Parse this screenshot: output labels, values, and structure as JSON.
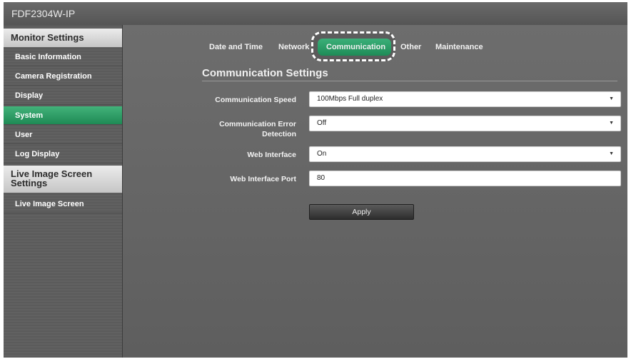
{
  "app": {
    "title": "FDF2304W-IP"
  },
  "sidebar": {
    "sections": [
      {
        "label": "Monitor Settings"
      },
      {
        "label": "Live Image Screen Settings"
      }
    ],
    "items": [
      {
        "label": "Basic Information"
      },
      {
        "label": "Camera Registration"
      },
      {
        "label": "Display"
      },
      {
        "label": "System"
      },
      {
        "label": "User"
      },
      {
        "label": "Log Display"
      },
      {
        "label": "Live Image Screen"
      }
    ],
    "active_item": "System"
  },
  "tabs": [
    {
      "label": "Date and Time"
    },
    {
      "label": "Network"
    },
    {
      "label": "Communication"
    },
    {
      "label": "Other"
    },
    {
      "label": "Maintenance"
    }
  ],
  "active_tab": "Communication",
  "main": {
    "section_title": "Communication Settings",
    "fields": [
      {
        "label": "Communication Speed",
        "value": "100Mbps Full duplex"
      },
      {
        "label": "Communication Error Detection",
        "value": "Off"
      },
      {
        "label": "Web Interface",
        "value": "On"
      },
      {
        "label": "Web Interface Port",
        "value": "80"
      }
    ],
    "apply_label": "Apply"
  },
  "colors": {
    "accent_green": "#2a9a63",
    "background": "#5f5f5f"
  }
}
